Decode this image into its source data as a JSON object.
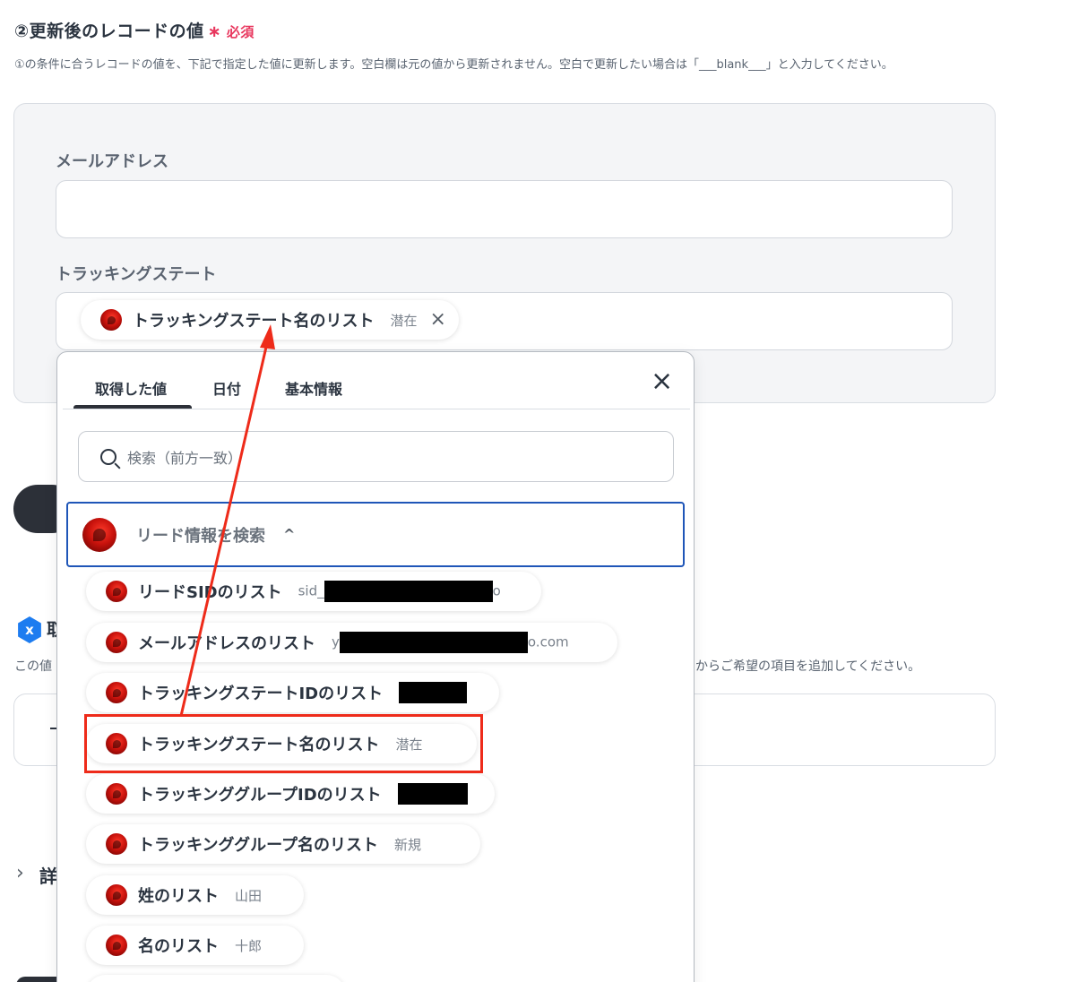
{
  "section": {
    "title": "②更新後のレコードの値",
    "required_mark": "∗",
    "required_label": "必須",
    "description": "①の条件に合うレコードの値を、下記で指定した値に更新します。空白欄は元の値から更新されません。空白で更新したい場合は「___blank___」と入力してください。"
  },
  "fields": {
    "email": {
      "label": "メールアドレス",
      "value": ""
    },
    "tracking_state": {
      "label": "トラッキングステート",
      "chip": {
        "label": "トラッキングステート名のリスト",
        "value": "潜在",
        "remove": "×"
      }
    }
  },
  "background": {
    "title_peek": "取",
    "desc_left": "この値",
    "desc_right": "からご希望の項目を追加してください。",
    "detail_peek": "詳",
    "chevron": "›",
    "hex_icon_text": "x"
  },
  "popup": {
    "tabs": [
      "取得した値",
      "日付",
      "基本情報"
    ],
    "active_tab": "取得した値",
    "close": "×",
    "search_placeholder": "検索（前方一致）",
    "group": {
      "title": "リード情報を検索",
      "chevron": "^"
    },
    "items": [
      {
        "label": "リードSIDのリスト",
        "value_prefix": "sid_",
        "value_suffix": "o",
        "redacted": true
      },
      {
        "label": "メールアドレスのリスト",
        "value_prefix": "y",
        "value_suffix": "o.com",
        "redacted": true
      },
      {
        "label": "トラッキングステートIDのリスト",
        "value_prefix": "",
        "value_suffix": "",
        "redacted": true
      },
      {
        "label": "トラッキングステート名のリスト",
        "value_prefix": "潜在",
        "value_suffix": "",
        "redacted": false,
        "highlighted": true
      },
      {
        "label": "トラッキンググループIDのリスト",
        "value_prefix": "",
        "value_suffix": "",
        "redacted": true
      },
      {
        "label": "トラッキンググループ名のリスト",
        "value_prefix": "新規",
        "value_suffix": "",
        "redacted": false
      },
      {
        "label": "姓のリスト",
        "value_prefix": "山田",
        "value_suffix": "",
        "redacted": false
      },
      {
        "label": "名のリスト",
        "value_prefix": "十郎",
        "value_suffix": "",
        "redacted": false
      }
    ]
  },
  "colors": {
    "required": "#e8365d",
    "highlight": "#ee2b1a",
    "group_border": "#1f56b8",
    "brand_icon": "#c8120c"
  }
}
